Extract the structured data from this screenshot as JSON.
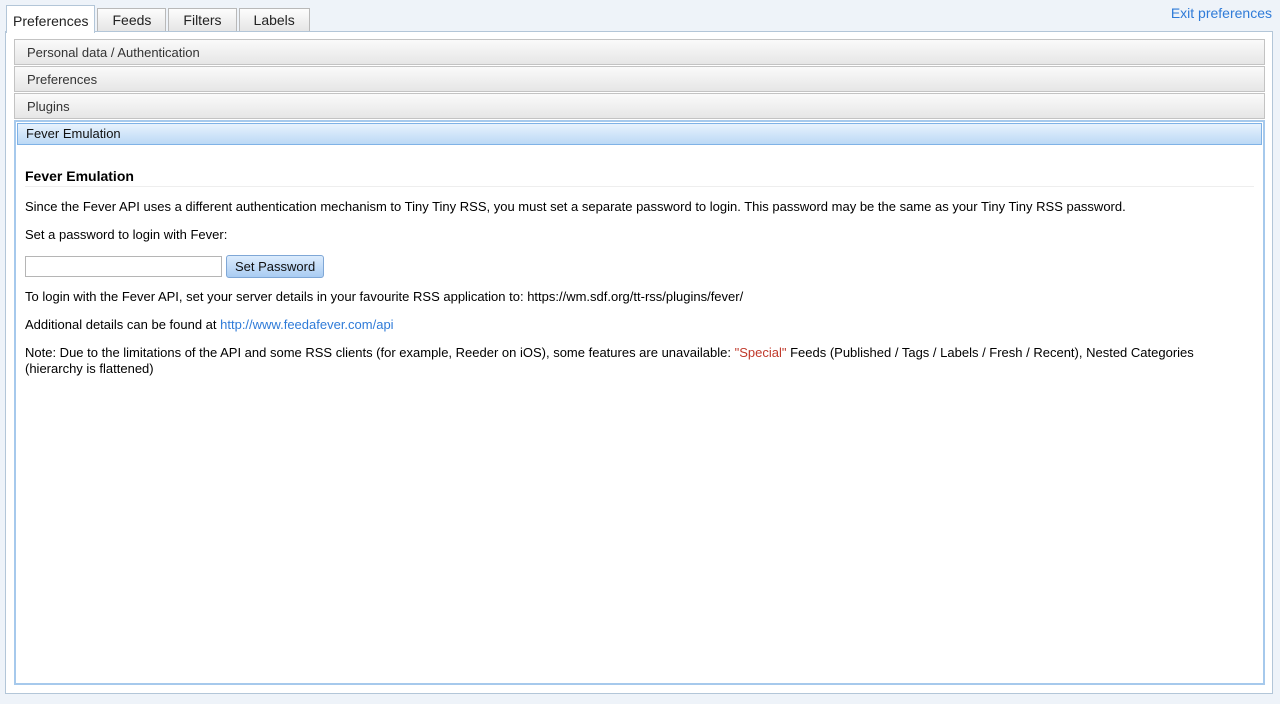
{
  "tabs": [
    {
      "label": "Preferences",
      "active": true
    },
    {
      "label": "Feeds",
      "active": false
    },
    {
      "label": "Filters",
      "active": false
    },
    {
      "label": "Labels",
      "active": false
    }
  ],
  "header": {
    "exit_label": "Exit preferences"
  },
  "accordion": {
    "sections": [
      {
        "label": "Personal data / Authentication"
      },
      {
        "label": "Preferences"
      },
      {
        "label": "Plugins"
      }
    ],
    "open_section": {
      "label": "Fever Emulation"
    }
  },
  "fever": {
    "title": "Fever Emulation",
    "intro": "Since the Fever API uses a different authentication mechanism to Tiny Tiny RSS, you must set a separate password to login. This password may be the same as your Tiny Tiny RSS password.",
    "set_password_prompt": "Set a password to login with Fever:",
    "password_value": "",
    "set_password_label": "Set Password",
    "login_info": "To login with the Fever API, set your server details in your favourite RSS application to: https://wm.sdf.org/tt-rss/plugins/fever/",
    "details_prefix": "Additional details can be found at ",
    "details_link": "http://www.feedafever.com/api",
    "note_before_quote": "Note: Due to the limitations of the API and some RSS clients (for example, Reeder on iOS), some features are unavailable: ",
    "note_quoted": "\"Special\"",
    "note_after_quote": " Feeds (Published / Tags / Labels / Fresh / Recent), Nested Categories (hierarchy is flattened)"
  },
  "colors": {
    "link": "#2f7bd8",
    "active_border": "#a6c9ec",
    "quote": "#c0392b"
  }
}
